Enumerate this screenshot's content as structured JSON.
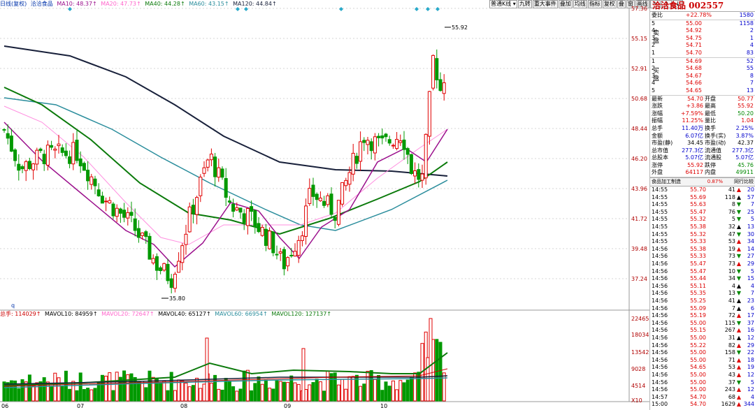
{
  "top_info": {
    "period": "日线(复权)",
    "name": "洽洽食品",
    "ma10": "MA10: 48.37↑",
    "ma20": "MA20: 47.73↑",
    "ma40": "MA40: 44.28↑",
    "ma60": "MA60: 43.15↑",
    "ma120": "MA120: 44.84↑"
  },
  "toolbar": {
    "kline_select": "普通K线 ▾",
    "b1": "九转",
    "b2": "重大事件",
    "b3": "叠加",
    "b4": "均线",
    "b5": "指标",
    "b6": "复权",
    "b7": "叠",
    "b8": "窗",
    "b9": "画线"
  },
  "price_axis": [
    "57.36",
    "55.15",
    "52.91",
    "50.68",
    "48.44",
    "46.20",
    "43.96",
    "41.72",
    "39.48",
    "37.24"
  ],
  "vol_axis": [
    "22465",
    "18034",
    "13542",
    "9028",
    "4514",
    "X10"
  ],
  "date_labels": [
    "06",
    "07",
    "08",
    "09",
    "10"
  ],
  "annotations": {
    "high": "55.92",
    "low": "35.80",
    "left_q": "q"
  },
  "vol_info": {
    "total": "总手: 114029↑",
    "mavol10": "MAVOL10: 84959↑",
    "mavol20": "MAVOL20: 72647↑",
    "mavol40": "MAVOL40: 65127↑",
    "mavol60": "MAVOL60: 66954↑",
    "mavol120": "MAVOL120: 127137↑"
  },
  "colors": {
    "ma10": "#9b0f8c",
    "ma20": "#ff8fe0",
    "ma40": "#0b7a0b",
    "ma60": "#2a8d9c",
    "ma120": "#18203a",
    "up": "#e00000",
    "down": "#009900",
    "axis": "#b00000"
  },
  "panel": {
    "title": "洽洽食品 002557",
    "weibi": {
      "k": "委比",
      "v": "+22.78%",
      "n": "1580"
    },
    "sell_label": "卖盘",
    "buy_label": "买盘",
    "sell": [
      {
        "l": "5",
        "p": "55.00",
        "v": "1158"
      },
      {
        "l": "4",
        "p": "54.92",
        "v": "2"
      },
      {
        "l": "3",
        "p": "54.75",
        "v": "1"
      },
      {
        "l": "2",
        "p": "54.71",
        "v": "4"
      },
      {
        "l": "1",
        "p": "54.70",
        "v": "83"
      }
    ],
    "buy": [
      {
        "l": "1",
        "p": "54.69",
        "v": "52"
      },
      {
        "l": "2",
        "p": "54.68",
        "v": "55"
      },
      {
        "l": "3",
        "p": "54.67",
        "v": "8"
      },
      {
        "l": "4",
        "p": "54.66",
        "v": "7"
      },
      {
        "l": "5",
        "p": "54.65",
        "v": "13"
      }
    ],
    "stats": [
      {
        "k": "最新",
        "v": "54.70",
        "vc": "r",
        "k2": "开盘",
        "v2": "50.77",
        "v2c": "r"
      },
      {
        "k": "涨跌",
        "v": "+3.86",
        "vc": "r",
        "k2": "最高",
        "v2": "55.92",
        "v2c": "r"
      },
      {
        "k": "涨幅",
        "v": "+7.59%",
        "vc": "r",
        "k2": "最低",
        "v2": "50.20",
        "v2c": "g"
      },
      {
        "k": "振幅",
        "v": "11.25%",
        "vc": "r",
        "k2": "量比",
        "v2": "1.04",
        "v2c": "r"
      },
      {
        "k": "总手",
        "v": "11.40万",
        "vc": "bl",
        "k2": "换手",
        "v2": "2.25%",
        "v2c": "bl"
      },
      {
        "k": "金额",
        "v": "6.07亿",
        "vc": "bl",
        "k2": "换手(实)",
        "v2": "3.87%",
        "v2c": "bl"
      },
      {
        "k": "市盈(静)",
        "v": "34.45",
        "vc": "b",
        "k2": "市盈(动)",
        "v2": "42.37",
        "v2c": "b"
      },
      {
        "k": "总市值",
        "v": "277.3亿",
        "vc": "bl",
        "k2": "流通值",
        "v2": "277.3亿",
        "v2c": "bl"
      },
      {
        "k": "总股本",
        "v": "5.07亿",
        "vc": "bl",
        "k2": "流通股",
        "v2": "5.07亿",
        "v2c": "bl"
      },
      {
        "k": "涨停",
        "v": "55.92",
        "vc": "r",
        "k2": "跌停",
        "v2": "45.76",
        "v2c": "g"
      },
      {
        "k": "外盘",
        "v": "64117",
        "vc": "r",
        "k2": "内盘",
        "v2": "49911",
        "v2c": "g"
      }
    ],
    "sector": {
      "name": "食品加工制造",
      "pct": "0.87%",
      "rank": "同行比较"
    },
    "ticks": [
      {
        "t": "14:55",
        "p": "55.70",
        "v": "41",
        "d": "▲",
        "dc": "r",
        "n": "20"
      },
      {
        "t": "14:55",
        "p": "55.69",
        "v": "118",
        "d": "▲",
        "dc": "b",
        "n": "57"
      },
      {
        "t": "14:55",
        "p": "55.63",
        "v": "8",
        "d": "▼",
        "dc": "g",
        "n": "7"
      },
      {
        "t": "14:55",
        "p": "55.47",
        "v": "76",
        "d": "▼",
        "dc": "g",
        "n": "25"
      },
      {
        "t": "14:55",
        "p": "55.32",
        "v": "5",
        "d": "▼",
        "dc": "g",
        "n": "5"
      },
      {
        "t": "14:55",
        "p": "55.38",
        "v": "32",
        "d": "▲",
        "dc": "b",
        "n": "13"
      },
      {
        "t": "14:55",
        "p": "55.32",
        "v": "47",
        "d": "▼",
        "dc": "g",
        "n": "30"
      },
      {
        "t": "14:55",
        "p": "55.33",
        "v": "53",
        "d": "▲",
        "dc": "r",
        "n": "34"
      },
      {
        "t": "14:56",
        "p": "55.38",
        "v": "19",
        "d": "▲",
        "dc": "r",
        "n": "14"
      },
      {
        "t": "14:56",
        "p": "55.33",
        "v": "73",
        "d": "▼",
        "dc": "g",
        "n": "27"
      },
      {
        "t": "14:56",
        "p": "55.47",
        "v": "73",
        "d": "▲",
        "dc": "r",
        "n": "29"
      },
      {
        "t": "14:56",
        "p": "55.47",
        "v": "10",
        "d": "▼",
        "dc": "g",
        "n": "5"
      },
      {
        "t": "14:56",
        "p": "55.44",
        "v": "34",
        "d": "▼",
        "dc": "g",
        "n": "15"
      },
      {
        "t": "14:56",
        "p": "55.11",
        "v": "4",
        "d": "▲",
        "dc": "b",
        "n": "4"
      },
      {
        "t": "14:56",
        "p": "55.35",
        "v": "13",
        "d": "▼",
        "dc": "g",
        "n": "7"
      },
      {
        "t": "14:56",
        "p": "55.25",
        "v": "41",
        "d": "▲",
        "dc": "b",
        "n": "23"
      },
      {
        "t": "14:56",
        "p": "55.09",
        "v": "7",
        "d": "▲",
        "dc": "b",
        "n": "6"
      },
      {
        "t": "14:56",
        "p": "55.19",
        "v": "72",
        "d": "▲",
        "dc": "r",
        "n": "17"
      },
      {
        "t": "14:56",
        "p": "55.00",
        "v": "115",
        "d": "▼",
        "dc": "g",
        "n": "37"
      },
      {
        "t": "14:56",
        "p": "55.15",
        "v": "267",
        "d": "▲",
        "dc": "r",
        "n": "16"
      },
      {
        "t": "14:56",
        "p": "55.00",
        "v": "31",
        "d": "▲",
        "dc": "b",
        "n": "12"
      },
      {
        "t": "14:56",
        "p": "55.22",
        "v": "82",
        "d": "▲",
        "dc": "r",
        "n": "29"
      },
      {
        "t": "14:56",
        "p": "55.00",
        "v": "158",
        "d": "▼",
        "dc": "g",
        "n": "22"
      },
      {
        "t": "14:56",
        "p": "55.00",
        "v": "71",
        "d": "▲",
        "dc": "r",
        "n": "18"
      },
      {
        "t": "14:56",
        "p": "54.65",
        "v": "53",
        "d": "▲",
        "dc": "r",
        "n": "19"
      },
      {
        "t": "14:56",
        "p": "55.00",
        "v": "43",
        "d": "▲",
        "dc": "r",
        "n": "12"
      },
      {
        "t": "14:56",
        "p": "55.00",
        "v": "37",
        "d": "▼",
        "dc": "g",
        "n": "5"
      },
      {
        "t": "14:56",
        "p": "55.00",
        "v": "243",
        "d": "▲",
        "dc": "r",
        "n": "12"
      },
      {
        "t": "14:57",
        "p": "54.70",
        "v": "68",
        "d": "▲",
        "dc": "r",
        "n": "4"
      },
      {
        "t": "15:00",
        "p": "54.70",
        "v": "1629",
        "d": "▲",
        "dc": "r",
        "n": "344"
      }
    ]
  }
}
